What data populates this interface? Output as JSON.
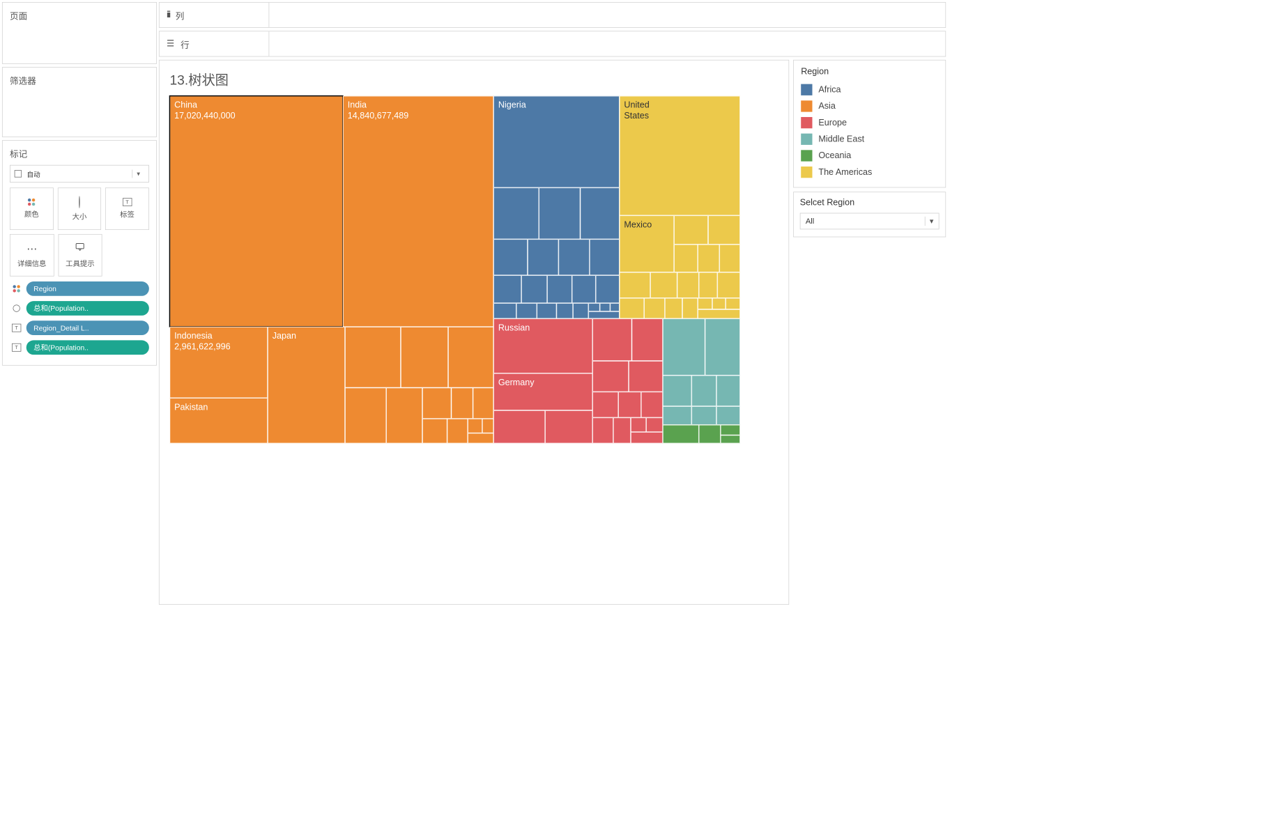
{
  "left": {
    "pages_title": "页面",
    "filters_title": "筛选器",
    "marks_title": "标记",
    "marks_select": "自动",
    "tiles": {
      "color": "颜色",
      "size": "大小",
      "label": "标签",
      "detail": "详细信息",
      "tooltip": "工具提示"
    },
    "pills": [
      {
        "icon": "dots",
        "cls": "blue",
        "label": "Region"
      },
      {
        "icon": "bubble",
        "cls": "teal",
        "label": "总和(Population.."
      },
      {
        "icon": "T",
        "cls": "blue",
        "label": "Region_Detail L.."
      },
      {
        "icon": "T",
        "cls": "teal",
        "label": "总和(Population.."
      }
    ]
  },
  "shelves": {
    "columns": "列",
    "rows": "行"
  },
  "viz": {
    "title": "13.树状图"
  },
  "legend": {
    "title": "Region",
    "items": [
      {
        "label": "Africa",
        "color": "#4d79a6"
      },
      {
        "label": "Asia",
        "color": "#ee8a31"
      },
      {
        "label": "Europe",
        "color": "#e05a60"
      },
      {
        "label": "Middle East",
        "color": "#76b7b2"
      },
      {
        "label": "Oceania",
        "color": "#5aa24f"
      },
      {
        "label": "The Americas",
        "color": "#ecc94b"
      }
    ]
  },
  "filter": {
    "title": "Selcet Region",
    "value": "All"
  },
  "chart_data": {
    "type": "treemap",
    "title": "13.树状图",
    "color_field": "Region",
    "size_field": "总和(Population)",
    "labeled_cells": [
      {
        "country": "China",
        "region": "Asia",
        "value": 17020440000,
        "selected": true
      },
      {
        "country": "India",
        "region": "Asia",
        "value": 14840677489
      },
      {
        "country": "Indonesia",
        "region": "Asia",
        "value": 2961622996
      },
      {
        "country": "Pakistan",
        "region": "Asia"
      },
      {
        "country": "Japan",
        "region": "Asia"
      },
      {
        "country": "Nigeria",
        "region": "Africa"
      },
      {
        "country": "United States",
        "region": "The Americas"
      },
      {
        "country": "Mexico",
        "region": "The Americas"
      },
      {
        "country": "Russian",
        "region": "Europe"
      },
      {
        "country": "Germany",
        "region": "Europe"
      }
    ],
    "colors": {
      "Africa": "#4d79a6",
      "Asia": "#ee8a31",
      "Europe": "#e05a60",
      "Middle East": "#76b7b2",
      "Oceania": "#5aa24f",
      "The Americas": "#ecc94b"
    }
  },
  "labels": {
    "china": "China",
    "china_v": "17,020,440,000",
    "india": "India",
    "india_v": "14,840,677,489",
    "indonesia": "Indonesia",
    "indonesia_v": "2,961,622,996",
    "pakistan": "Pakistan",
    "japan": "Japan",
    "nigeria": "Nigeria",
    "us1": "United",
    "us2": "States",
    "mexico": "Mexico",
    "russian": "Russian",
    "germany": "Germany"
  }
}
